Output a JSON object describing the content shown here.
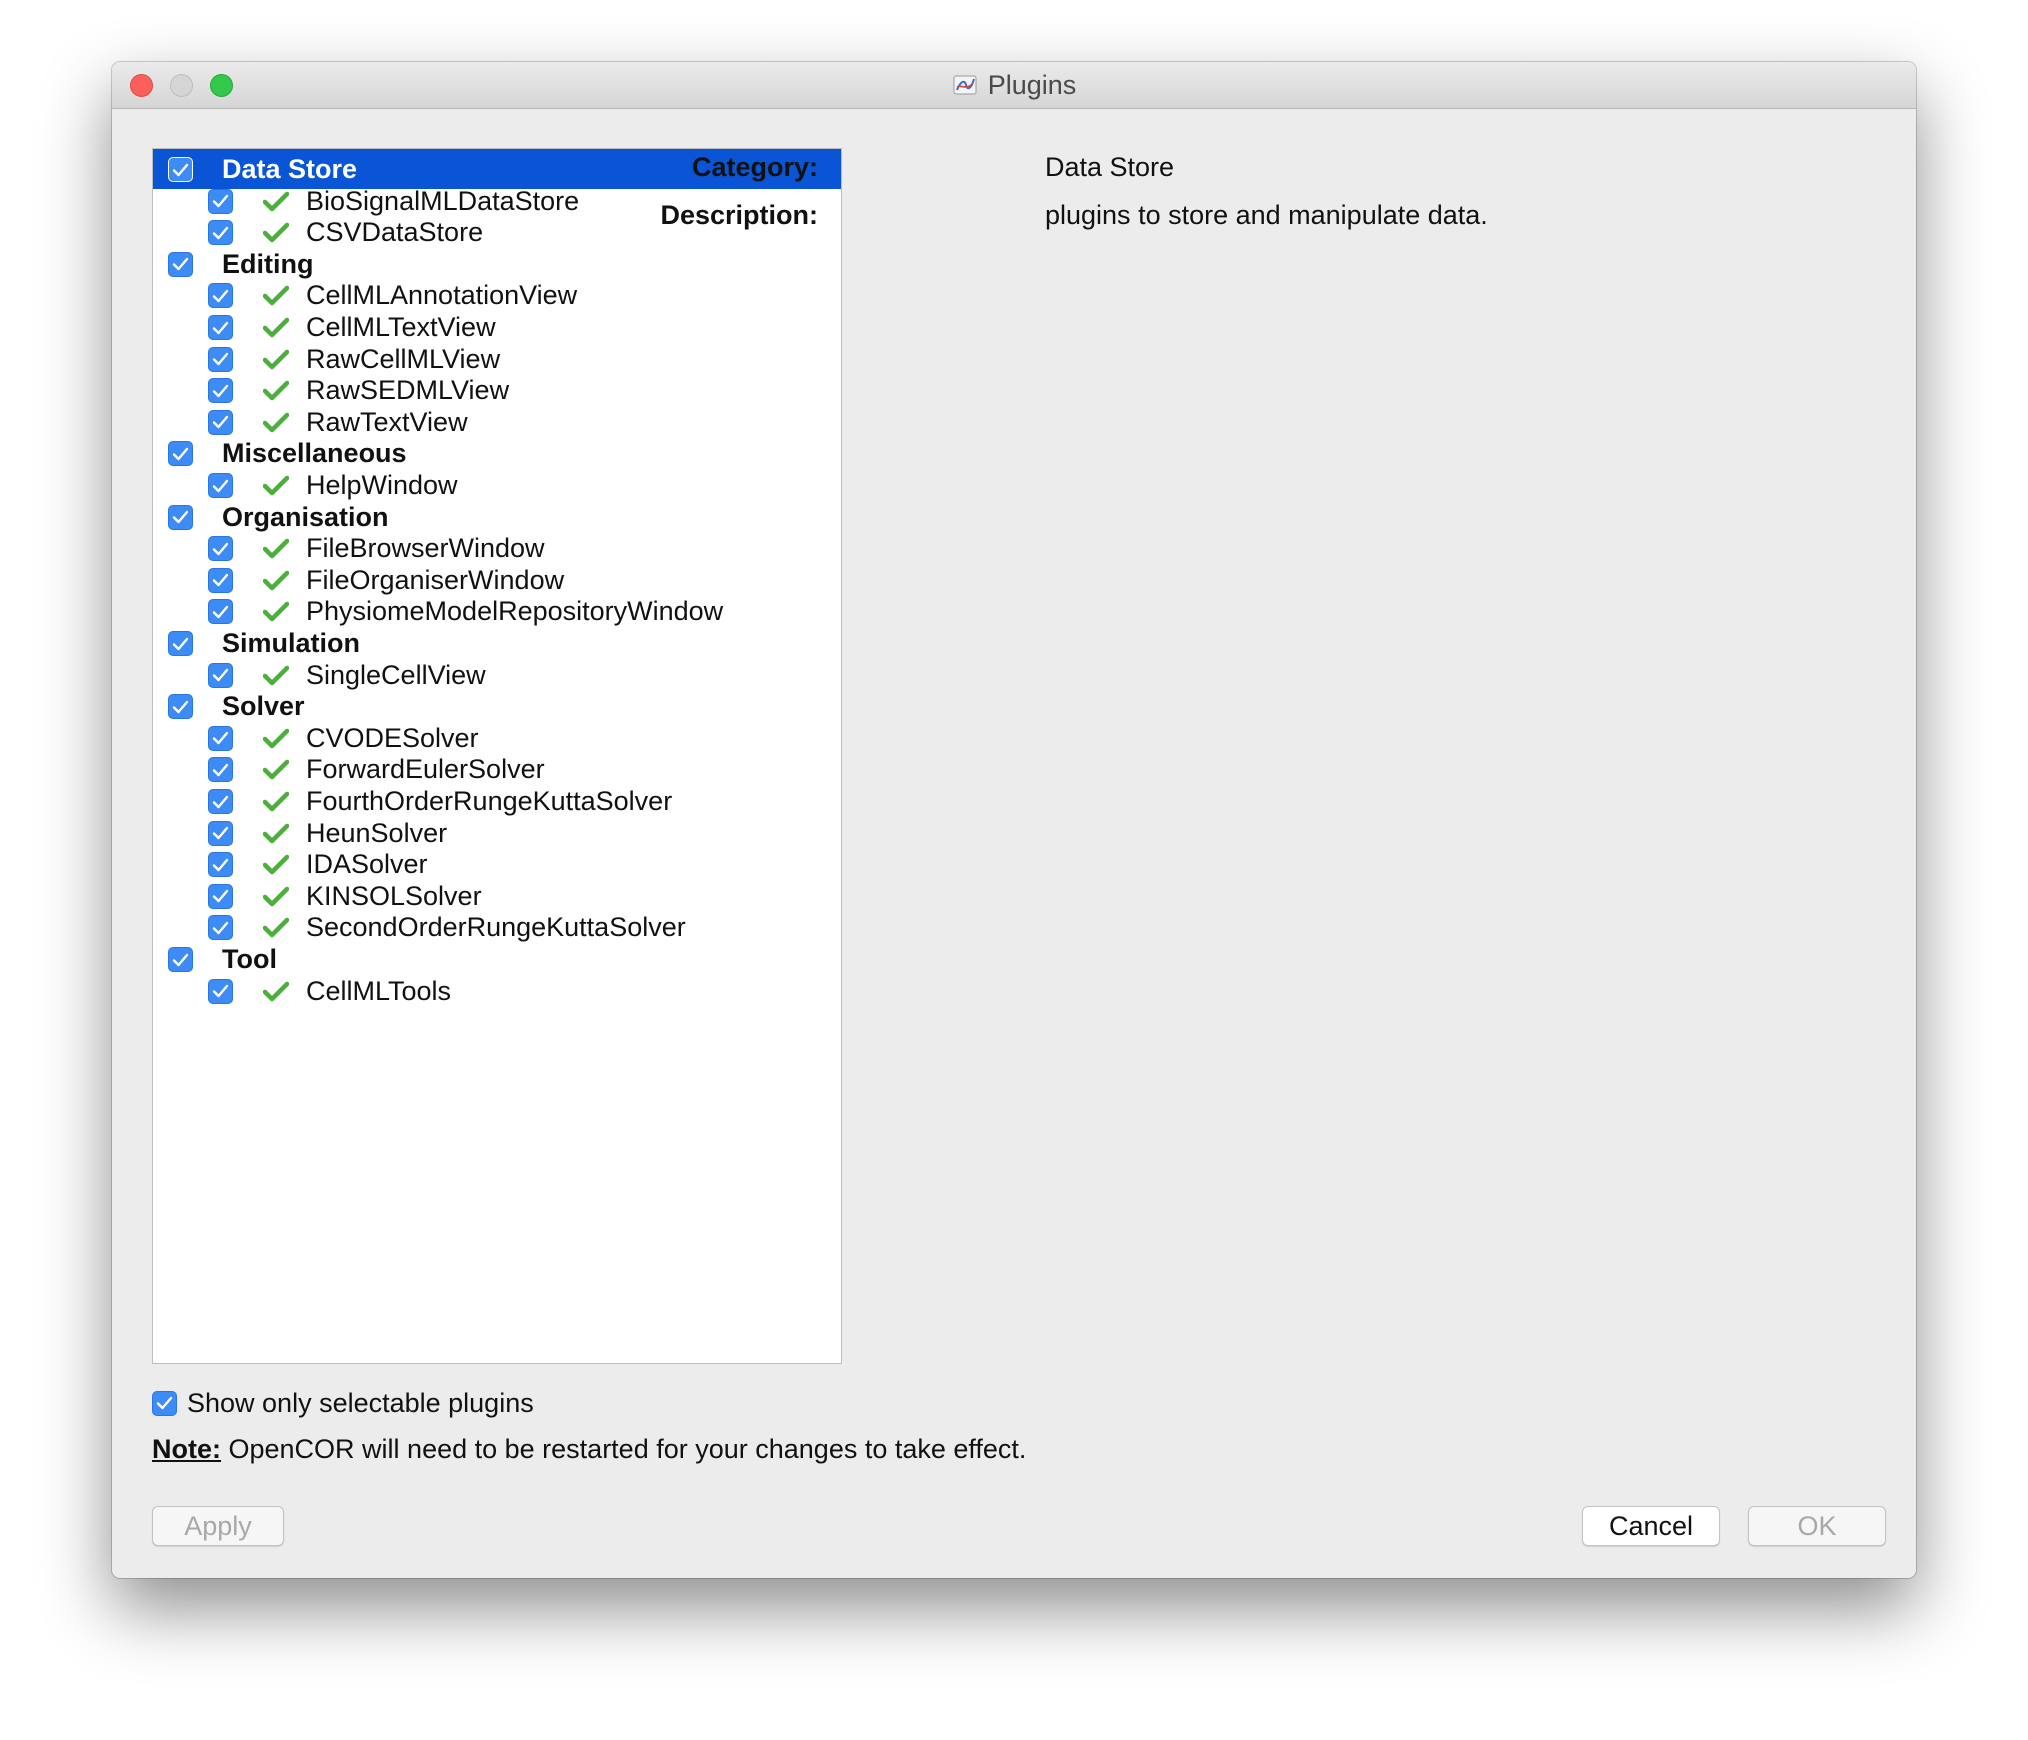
{
  "window": {
    "title": "Plugins",
    "app_icon": "opencor-app-icon"
  },
  "tree": {
    "rows": [
      {
        "kind": "category",
        "label": "Data Store",
        "checked": true,
        "selected": true
      },
      {
        "kind": "plugin",
        "label": "BioSignalMLDataStore",
        "checked": true,
        "status": "ok"
      },
      {
        "kind": "plugin",
        "label": "CSVDataStore",
        "checked": true,
        "status": "ok"
      },
      {
        "kind": "category",
        "label": "Editing",
        "checked": true
      },
      {
        "kind": "plugin",
        "label": "CellMLAnnotationView",
        "checked": true,
        "status": "ok"
      },
      {
        "kind": "plugin",
        "label": "CellMLTextView",
        "checked": true,
        "status": "ok"
      },
      {
        "kind": "plugin",
        "label": "RawCellMLView",
        "checked": true,
        "status": "ok"
      },
      {
        "kind": "plugin",
        "label": "RawSEDMLView",
        "checked": true,
        "status": "ok"
      },
      {
        "kind": "plugin",
        "label": "RawTextView",
        "checked": true,
        "status": "ok"
      },
      {
        "kind": "category",
        "label": "Miscellaneous",
        "checked": true
      },
      {
        "kind": "plugin",
        "label": "HelpWindow",
        "checked": true,
        "status": "ok"
      },
      {
        "kind": "category",
        "label": "Organisation",
        "checked": true
      },
      {
        "kind": "plugin",
        "label": "FileBrowserWindow",
        "checked": true,
        "status": "ok"
      },
      {
        "kind": "plugin",
        "label": "FileOrganiserWindow",
        "checked": true,
        "status": "ok"
      },
      {
        "kind": "plugin",
        "label": "PhysiomeModelRepositoryWindow",
        "checked": true,
        "status": "ok"
      },
      {
        "kind": "category",
        "label": "Simulation",
        "checked": true
      },
      {
        "kind": "plugin",
        "label": "SingleCellView",
        "checked": true,
        "status": "ok"
      },
      {
        "kind": "category",
        "label": "Solver",
        "checked": true
      },
      {
        "kind": "plugin",
        "label": "CVODESolver",
        "checked": true,
        "status": "ok"
      },
      {
        "kind": "plugin",
        "label": "ForwardEulerSolver",
        "checked": true,
        "status": "ok"
      },
      {
        "kind": "plugin",
        "label": "FourthOrderRungeKuttaSolver",
        "checked": true,
        "status": "ok"
      },
      {
        "kind": "plugin",
        "label": "HeunSolver",
        "checked": true,
        "status": "ok"
      },
      {
        "kind": "plugin",
        "label": "IDASolver",
        "checked": true,
        "status": "ok"
      },
      {
        "kind": "plugin",
        "label": "KINSOLSolver",
        "checked": true,
        "status": "ok"
      },
      {
        "kind": "plugin",
        "label": "SecondOrderRungeKuttaSolver",
        "checked": true,
        "status": "ok"
      },
      {
        "kind": "category",
        "label": "Tool",
        "checked": true
      },
      {
        "kind": "plugin",
        "label": "CellMLTools",
        "checked": true,
        "status": "ok"
      }
    ]
  },
  "details": {
    "category_label": "Category:",
    "category_value": "Data Store",
    "description_label": "Description:",
    "description_value": "plugins to store and manipulate data."
  },
  "options": {
    "show_only_selectable_label": "Show only selectable plugins",
    "show_only_selectable_checked": true
  },
  "note": {
    "label": "Note:",
    "text": " OpenCOR will need to be restarted for your changes to take effect."
  },
  "buttons": {
    "apply": "Apply",
    "cancel": "Cancel",
    "ok": "OK"
  },
  "colors": {
    "selection": "#0a55d6",
    "checkbox": "#3d8cf5",
    "status_ok": "#4cae3b"
  }
}
